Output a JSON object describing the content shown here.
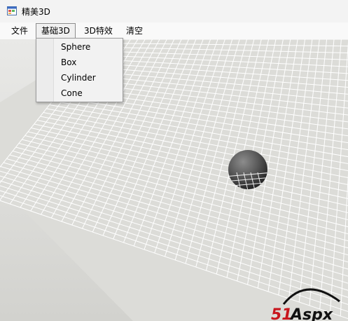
{
  "window": {
    "title": "精美3D",
    "icon": "winforms-app-icon"
  },
  "menubar": {
    "items": [
      {
        "label": "文件"
      },
      {
        "label": "基础3D"
      },
      {
        "label": "3D特效"
      },
      {
        "label": "清空"
      }
    ]
  },
  "dropdown": {
    "items": [
      {
        "label": "Sphere"
      },
      {
        "label": "Box"
      },
      {
        "label": "Cylinder"
      },
      {
        "label": "Cone"
      }
    ]
  },
  "scene": {
    "objects": [
      "sphere"
    ],
    "floor": "grid-plane"
  },
  "watermark": {
    "text": "51Aspx"
  },
  "colors": {
    "grid_line": "#ffffff",
    "floor": "#d6d6d2",
    "sphere": "#5a5a5a",
    "watermark_red": "#c8161d"
  }
}
